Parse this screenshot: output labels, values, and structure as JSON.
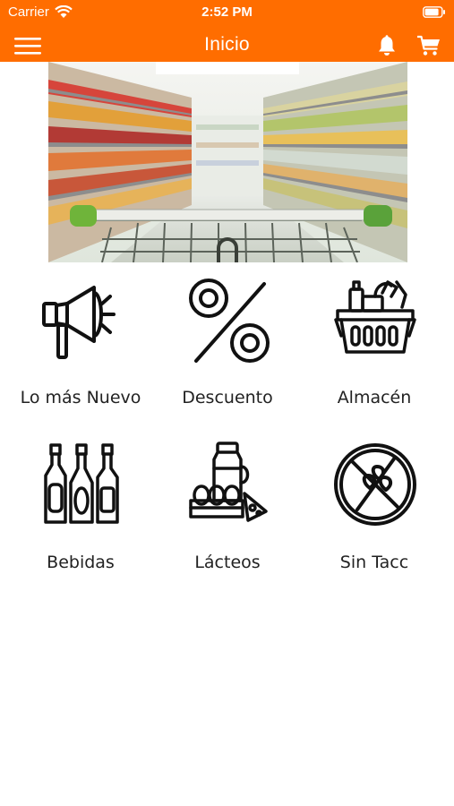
{
  "status_bar": {
    "carrier": "Carrier",
    "time": "2:52 PM"
  },
  "header": {
    "title": "Inicio",
    "color": "#ff6d00"
  },
  "categories": [
    {
      "label": "Lo más Nuevo",
      "icon": "megaphone-icon"
    },
    {
      "label": "Descuento",
      "icon": "percent-icon"
    },
    {
      "label": "Almacén",
      "icon": "grocery-basket-icon"
    },
    {
      "label": "Bebidas",
      "icon": "bottles-icon"
    },
    {
      "label": "Lácteos",
      "icon": "dairy-icon"
    },
    {
      "label": "Sin Tacc",
      "icon": "gluten-free-icon"
    }
  ]
}
